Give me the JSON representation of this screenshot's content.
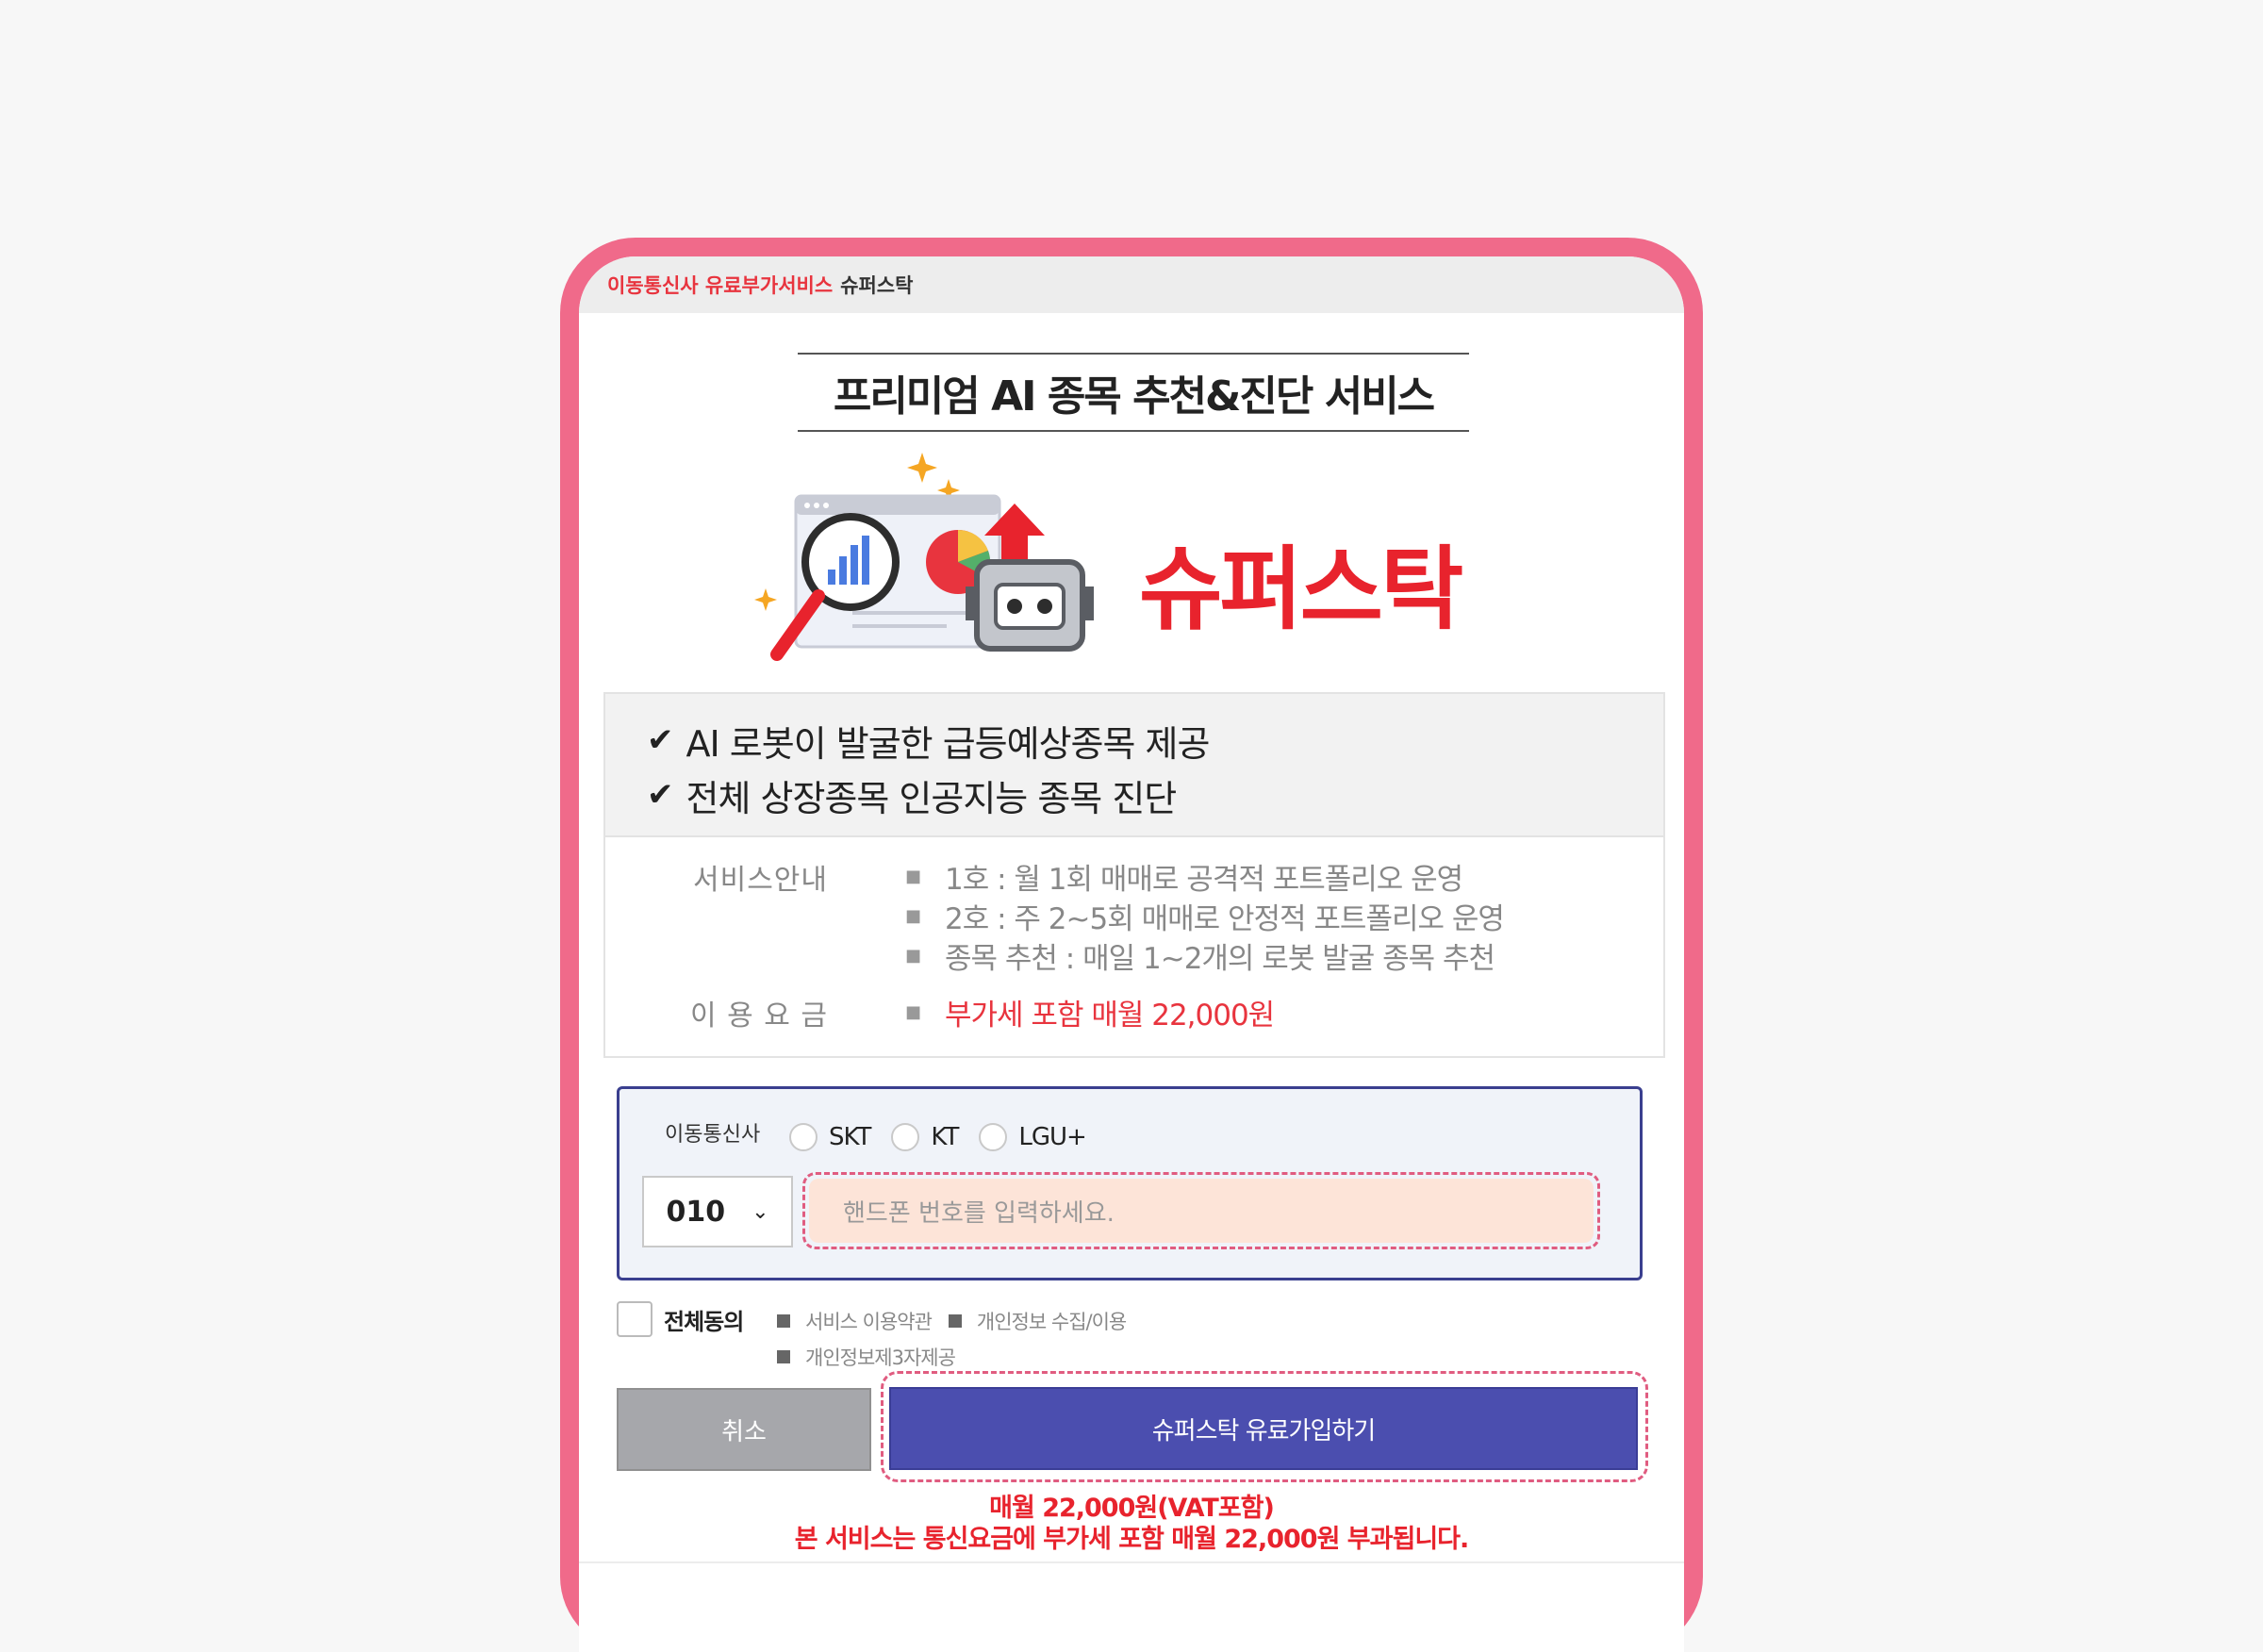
{
  "topbar": {
    "category": "이동통신사 유료부가서비스",
    "service": "슈퍼스탁"
  },
  "headline": "프리미엄 AI 종목 추천&진단 서비스",
  "brand": "슈퍼스탁",
  "features": [
    "AI 로봇이 발굴한 급등예상종목 제공",
    "전체 상장종목 인공지능 종목 진단"
  ],
  "info": {
    "service_label": "서비스안내",
    "service_items": [
      "1호 : 월 1회 매매로 공격적 포트폴리오 운영",
      "2호 : 주 2~5회 매매로 안정적 포트폴리오 운영",
      "종목 추천 : 매일 1~2개의 로봇 발굴 종목 추천"
    ],
    "fee_label": "이 용 요 금",
    "fee_value": "부가세 포함 매월 22,000원"
  },
  "form": {
    "carrier_label": "이동통신사",
    "carriers": [
      "SKT",
      "KT",
      "LGU+"
    ],
    "prefix": "010",
    "phone_placeholder": "핸드폰 번호를 입력하세요."
  },
  "agreement": {
    "all_label": "전체동의",
    "terms": [
      "서비스 이용약관",
      "개인정보 수집/이용",
      "개인정보제3자제공"
    ]
  },
  "buttons": {
    "cancel": "취소",
    "join": "슈퍼스탁 유료가입하기"
  },
  "notices": {
    "line1": "매월 22,000원(VAT포함)",
    "line2": "본 서비스는 통신요금에 부가세 포함 매월 22,000원 부과됩니다."
  },
  "colors": {
    "frame": "#f06a8a",
    "accent_red": "#e8232d",
    "join_button": "#4b4eaf",
    "form_border": "#3a3f8f",
    "phone_field": "#fde4d8"
  }
}
